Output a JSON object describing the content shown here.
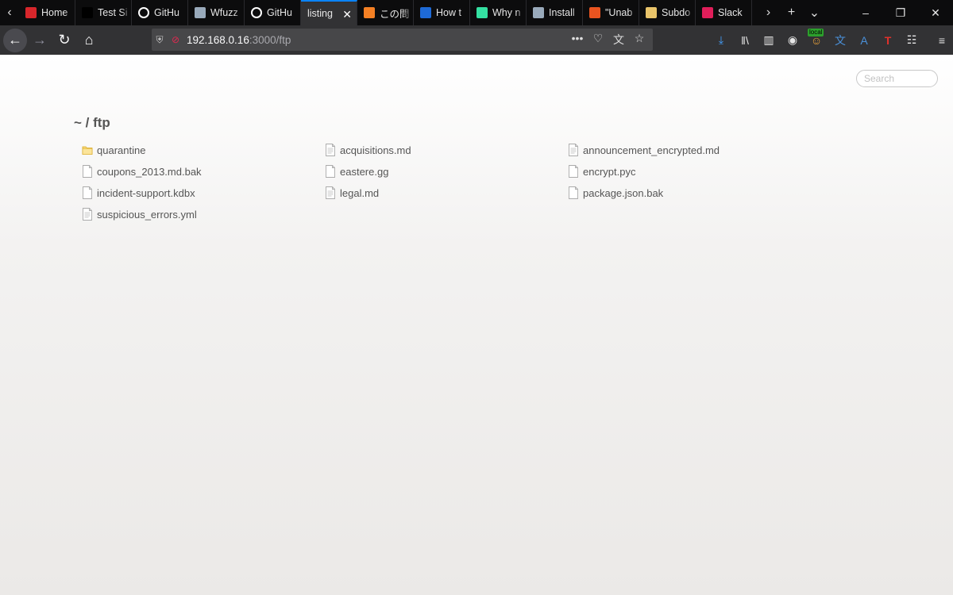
{
  "browser": {
    "tabs": [
      {
        "title": "Home",
        "icon": "home-favicon",
        "color": "#d7262b"
      },
      {
        "title": "Test Si",
        "icon": "black-square-favicon",
        "color": "#000000"
      },
      {
        "title": "GitHu",
        "icon": "github-icon",
        "color": "#ffffff"
      },
      {
        "title": "Wfuzz",
        "icon": "doc-favicon",
        "color": "#9ab"
      },
      {
        "title": "GitHu",
        "icon": "github-icon",
        "color": "#ffffff"
      },
      {
        "title": "listing",
        "icon": "",
        "color": "",
        "active": true
      },
      {
        "title": "この問",
        "icon": "stackoverflow-icon",
        "color": "#f48024"
      },
      {
        "title": "How t",
        "icon": "blue-square-favicon",
        "color": "#1e6ad6"
      },
      {
        "title": "Why n",
        "icon": "tripadvisor-icon",
        "color": "#34e0a1"
      },
      {
        "title": "Install",
        "icon": "doc-favicon",
        "color": "#9ab"
      },
      {
        "title": "\"Unab",
        "icon": "askubuntu-icon",
        "color": "#e95420"
      },
      {
        "title": "Subdo",
        "icon": "person-favicon",
        "color": "#e9c46a"
      },
      {
        "title": "Slack",
        "icon": "slack-icon",
        "color": "#e01e5a"
      }
    ],
    "url": {
      "host": "192.168.0.16",
      "rest": ":3000/ftp"
    },
    "toolbar_badge": "local"
  },
  "page": {
    "search_placeholder": "Search",
    "breadcrumb": "~ / ftp",
    "files": [
      {
        "name": "quarantine",
        "type": "folder"
      },
      {
        "name": "acquisitions.md",
        "type": "text"
      },
      {
        "name": "announcement_encrypted.md",
        "type": "text"
      },
      {
        "name": "coupons_2013.md.bak",
        "type": "file"
      },
      {
        "name": "eastere.gg",
        "type": "file"
      },
      {
        "name": "encrypt.pyc",
        "type": "file"
      },
      {
        "name": "incident-support.kdbx",
        "type": "file"
      },
      {
        "name": "legal.md",
        "type": "text"
      },
      {
        "name": "package.json.bak",
        "type": "file"
      },
      {
        "name": "suspicious_errors.yml",
        "type": "text"
      }
    ]
  }
}
